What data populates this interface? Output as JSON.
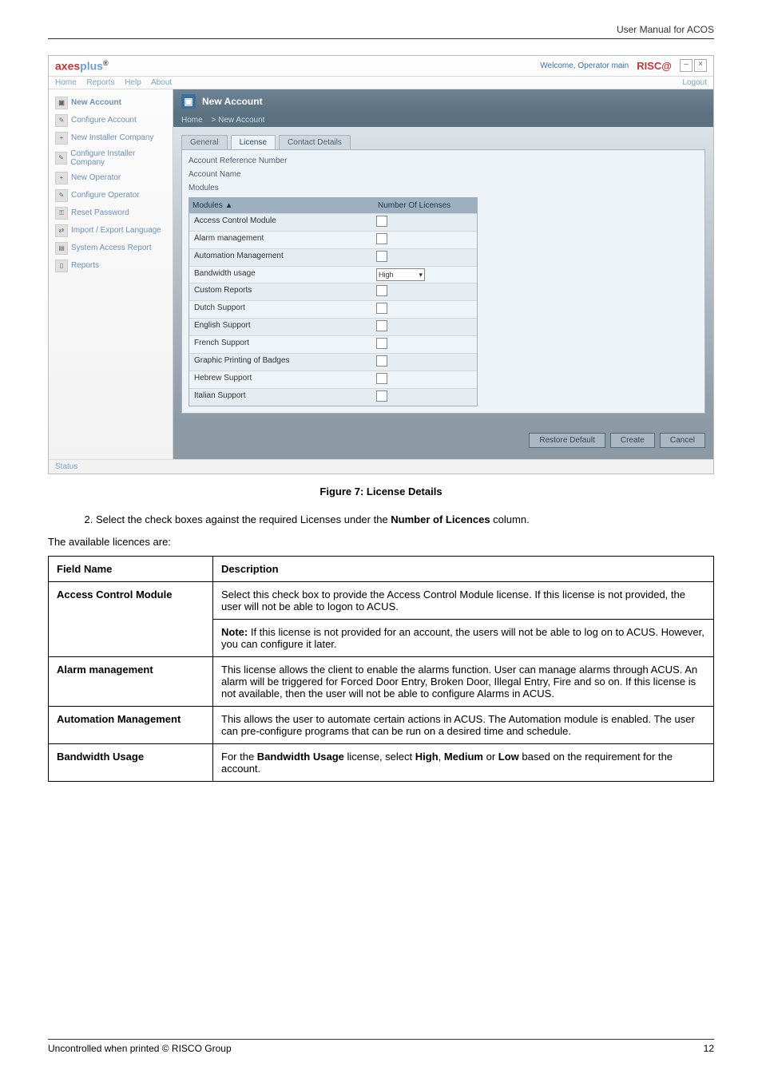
{
  "doc": {
    "header_right": "User Manual for ACOS",
    "figure_caption": "Figure 7: License Details",
    "step_2_before": "Select the check boxes against the required Licenses under the ",
    "step_2_bold": "Number of Licences",
    "step_2_after": " column.",
    "intro": "The available licences are:",
    "table": {
      "h1": "Field Name",
      "h2": "Description",
      "row1_name": "Access Control Module",
      "row1_desc": "Select this check box to provide the Access Control Module license. If this license is not provided, the user will not be able to logon to ACUS.",
      "row1_note_bold": "Note:",
      "row1_note_text": " If this license is not provided for an account, the users will not be able to log on to ACUS. However, you can configure it later.",
      "row2_name": "Alarm management",
      "row2_desc": "This license allows the client to enable the alarms function. User can manage alarms through ACUS. An alarm will be triggered for Forced Door Entry, Broken Door, Illegal Entry, Fire and so on. If this license is not available, then the user will not be able to configure Alarms in ACUS.",
      "row3_name": "Automation Management",
      "row3_desc": "This allows the user to automate certain actions in ACUS. The Automation module is enabled. The user can pre-configure programs that can be run on a desired time and schedule.",
      "row4_name": "Bandwidth Usage",
      "row4_desc_before": "For the ",
      "row4_desc_b1": "Bandwidth Usage",
      "row4_desc_mid1": " license, select ",
      "row4_desc_b2": "High",
      "row4_desc_sep1": ", ",
      "row4_desc_b3": "Medium",
      "row4_desc_sep2": " or ",
      "row4_desc_b4": "Low",
      "row4_desc_after": " based on the requirement for the account."
    },
    "footer_left": "Uncontrolled when printed © RISCO Group",
    "footer_right": "12"
  },
  "app": {
    "logo_prefix": "axes",
    "logo_suffix": "plus",
    "welcome": "Welcome, Operator main",
    "risco": "RISC@",
    "menu": {
      "home": "Home",
      "reports": "Reports",
      "help": "Help",
      "about": "About",
      "logout": "Logout"
    },
    "status": "Status",
    "sidebar": [
      "New Account",
      "Configure Account",
      "New Installer Company",
      "Configure Installer Company",
      "New Operator",
      "Configure Operator",
      "Reset Password",
      "Import / Export Language",
      "System Access Report",
      "Reports"
    ],
    "panel_title": "New Account",
    "crumb_home": "Home",
    "crumb_here": "New Account",
    "tabs": {
      "general": "General",
      "license": "License",
      "contact": "Contact Details"
    },
    "fields": {
      "ref": "Account Reference Number",
      "name": "Account Name",
      "modules": "Modules"
    },
    "grid": {
      "h_mod": "Modules",
      "h_num": "Number Of Licenses",
      "rows": [
        "Access Control Module",
        "Alarm management",
        "Automation Management",
        "Bandwidth usage",
        "Custom Reports",
        "Dutch Support",
        "English Support",
        "French Support",
        "Graphic Printing of Badges",
        "Hebrew Support",
        "Italian Support"
      ],
      "bw_value": "High"
    },
    "buttons": {
      "restore": "Restore Default",
      "create": "Create",
      "cancel": "Cancel"
    }
  }
}
